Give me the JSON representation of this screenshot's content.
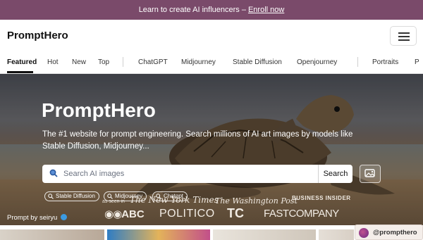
{
  "promo": {
    "text": "Learn to create AI influencers –",
    "link": "Enroll now"
  },
  "header": {
    "logo": "PromptHero"
  },
  "tabs": [
    "Featured",
    "Hot",
    "New",
    "Top",
    "ChatGPT",
    "Midjourney",
    "Stable Diffusion",
    "Openjourney",
    "Portraits",
    "P"
  ],
  "hero": {
    "title": "PromptHero",
    "subtitle": "The #1 website for prompt engineering. Search millions of AI art images by models like Stable Diffusion, Midjourney...",
    "search_placeholder": "Search AI images",
    "search_button": "Search",
    "chips": [
      "Stable Diffusion",
      "Midjourney",
      "Chatgpt"
    ],
    "seen_as": "as seen in",
    "press": [
      "The New York Times",
      "The Washington Post",
      "BUSINESS INSIDER",
      "ABC",
      "POLITICO",
      "TC",
      "FASTCOMPANY"
    ],
    "credit_prefix": "Prompt by",
    "credit_user": "seiryu"
  },
  "badge": {
    "handle": "@prompthero"
  },
  "colors": {
    "promo_bg": "#7a4a6a",
    "accent": "#111111",
    "verified": "#3b9ae1"
  }
}
